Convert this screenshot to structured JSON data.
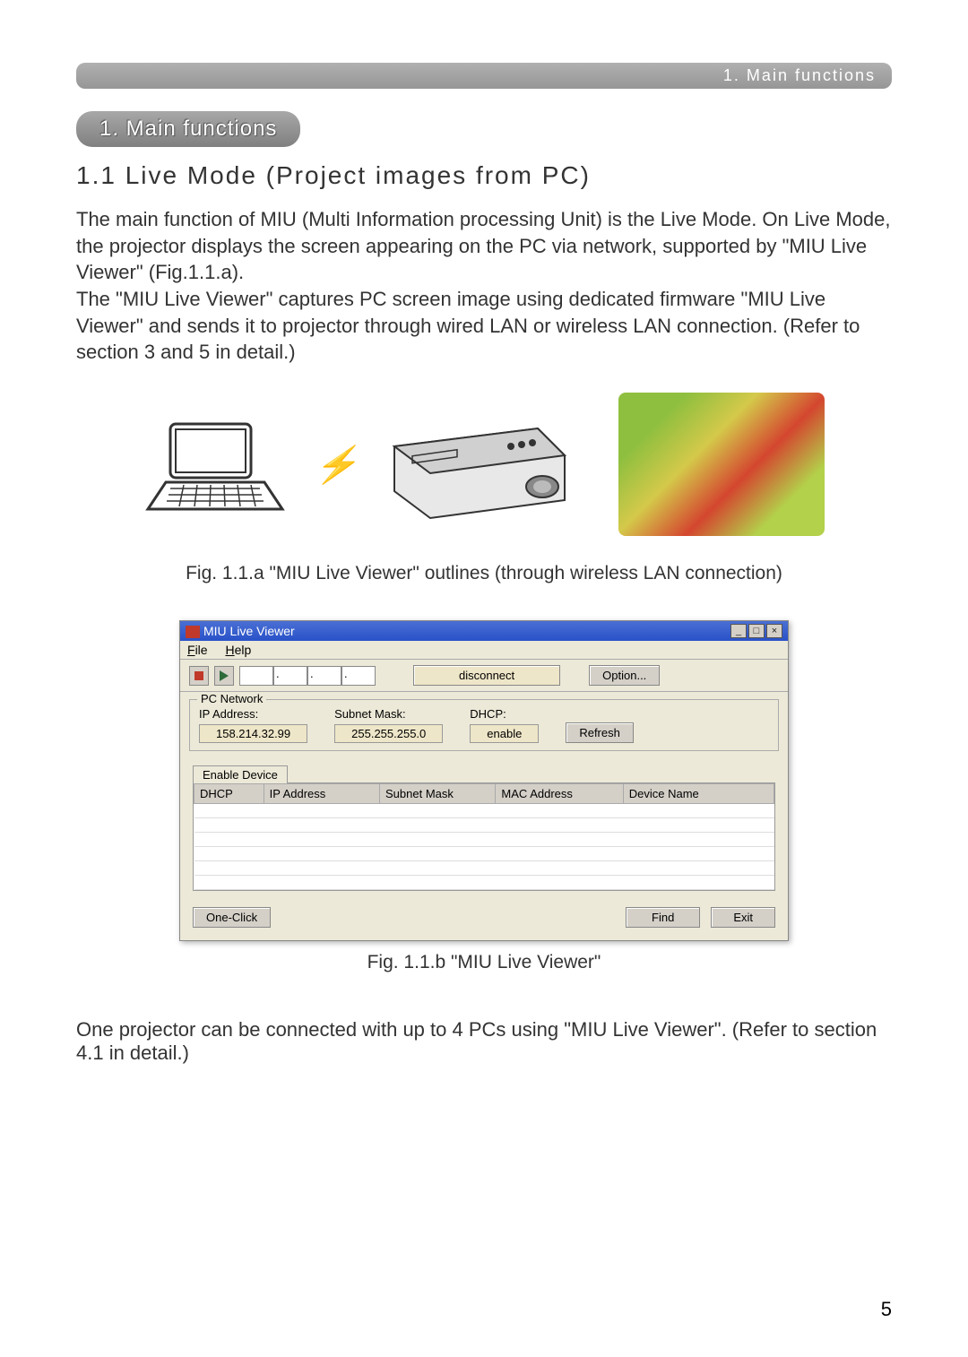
{
  "header": {
    "tab_label": "1. Main functions"
  },
  "section": {
    "pill": "1. Main functions"
  },
  "subsection": {
    "title": "1.1 Live Mode (Project images from PC)"
  },
  "body": {
    "para1": "The main function of MIU (Multi Information processing Unit) is the Live Mode. On Live Mode, the projector displays the screen appearing on the PC via network, supported by \"MIU Live Viewer\" (Fig.1.1.a).\nThe \"MIU Live Viewer\" captures PC screen image using dedicated firmware \"MIU Live Viewer\" and sends it to projector through wired LAN or wireless LAN connection. (Refer to section 3 and 5 in detail.)"
  },
  "caption_a": "Fig. 1.1.a \"MIU Live Viewer\" outlines (through wireless LAN connection)",
  "app": {
    "title": "MIU Live Viewer",
    "menu": {
      "file": "File",
      "help": "Help"
    },
    "toolbar": {
      "disconnect": "disconnect",
      "option": "Option..."
    },
    "pc_network": {
      "legend": "PC Network",
      "ip_label": "IP Address:",
      "ip_value": "158.214.32.99",
      "subnet_label": "Subnet Mask:",
      "subnet_value": "255.255.255.0",
      "dhcp_label": "DHCP:",
      "dhcp_value": "enable",
      "refresh": "Refresh"
    },
    "tab": "Enable Device",
    "table_headers": {
      "dhcp": "DHCP",
      "ip": "IP Address",
      "subnet": "Subnet Mask",
      "mac": "MAC Address",
      "name": "Device Name"
    },
    "buttons": {
      "oneclick": "One-Click",
      "find": "Find",
      "exit": "Exit"
    }
  },
  "caption_b": "Fig. 1.1.b \"MIU Live Viewer\"",
  "footer": "One projector can be connected with up to 4 PCs using \"MIU Live Viewer\". (Refer to section 4.1 in detail.)",
  "page_num": "5"
}
